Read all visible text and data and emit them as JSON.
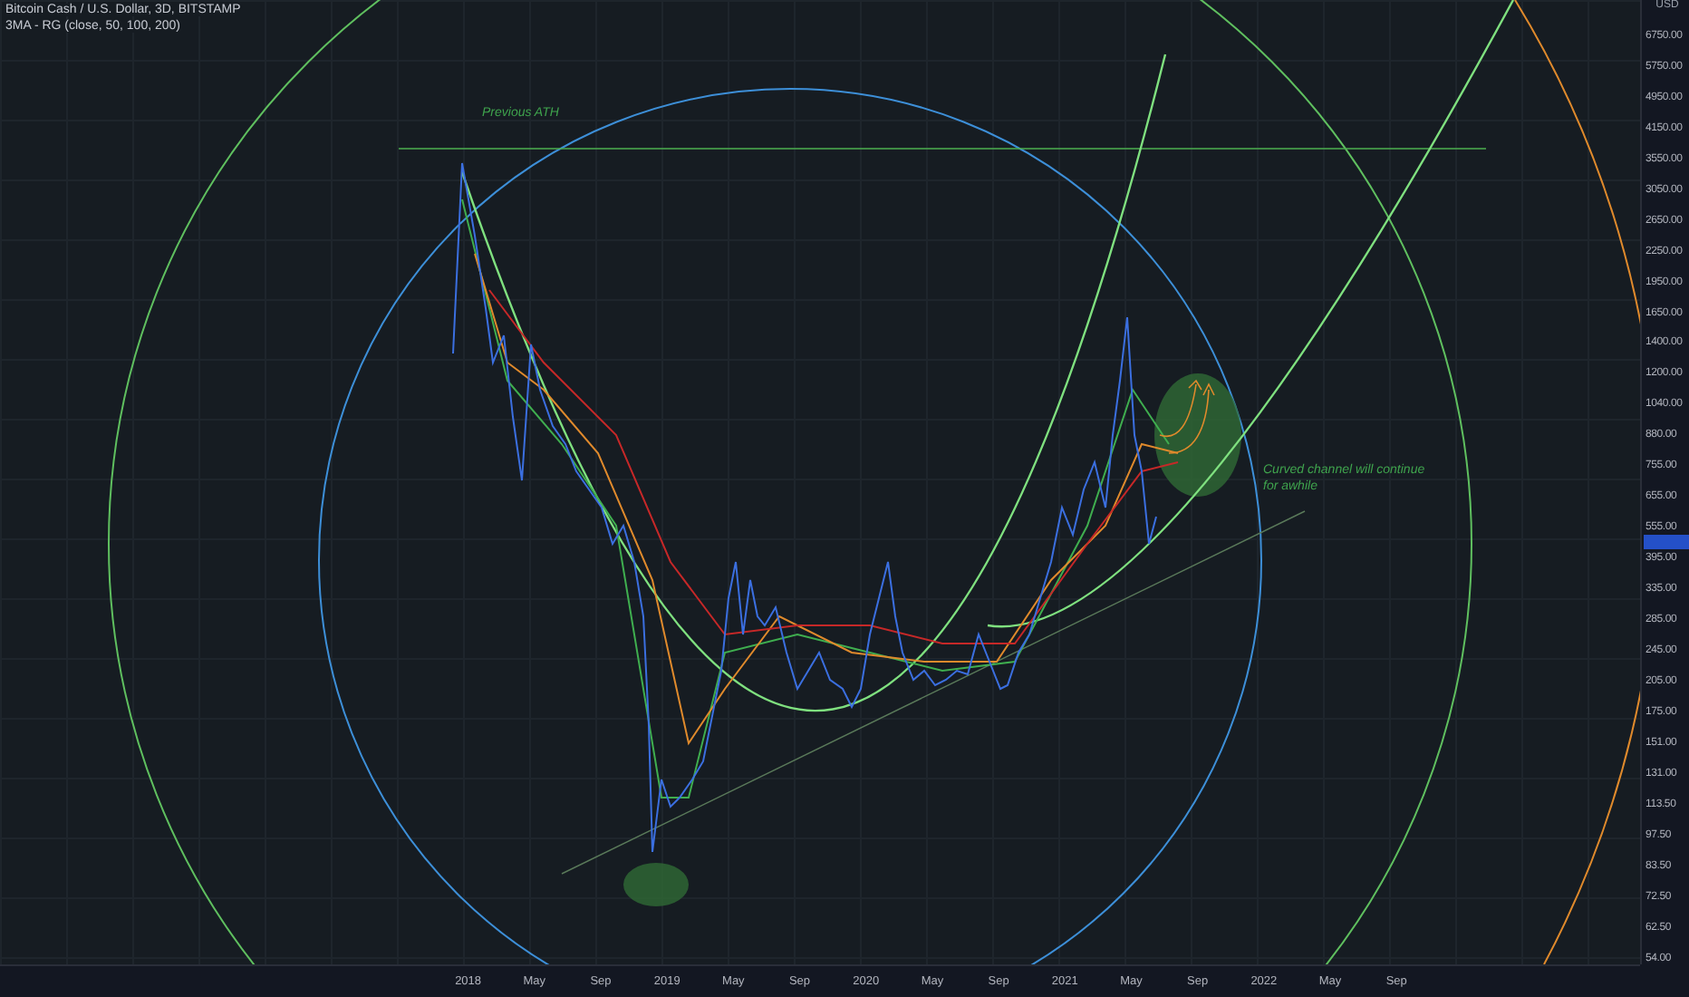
{
  "legend": {
    "symbol": "Bitcoin Cash / U.S. Dollar, 3D, BITSTAMP",
    "indicator": "3MA - RG (close, 50, 100, 200)"
  },
  "annotations": [
    {
      "kind": "label",
      "text": "Previous ATH"
    },
    {
      "kind": "note",
      "text": "Curved channel will continue for awhile"
    }
  ],
  "price_axis": {
    "currency": "USD",
    "labels": [
      "6750.00",
      "5750.00",
      "4950.00",
      "4150.00",
      "3550.00",
      "3050.00",
      "2650.00",
      "2250.00",
      "1950.00",
      "1650.00",
      "1400.00",
      "1200.00",
      "1040.00",
      "880.00",
      "755.00",
      "655.00",
      "555.00",
      "395.00",
      "335.00",
      "285.00",
      "245.00",
      "205.00",
      "175.00",
      "151.00",
      "131.00",
      "113.50",
      "97.50",
      "83.50",
      "72.50",
      "62.50",
      "54.00"
    ]
  },
  "time_axis": {
    "labels": [
      "2018",
      "May",
      "Sep",
      "2019",
      "May",
      "Sep",
      "2020",
      "May",
      "Sep",
      "2021",
      "May",
      "Sep",
      "2022",
      "May",
      "Sep"
    ]
  }
}
